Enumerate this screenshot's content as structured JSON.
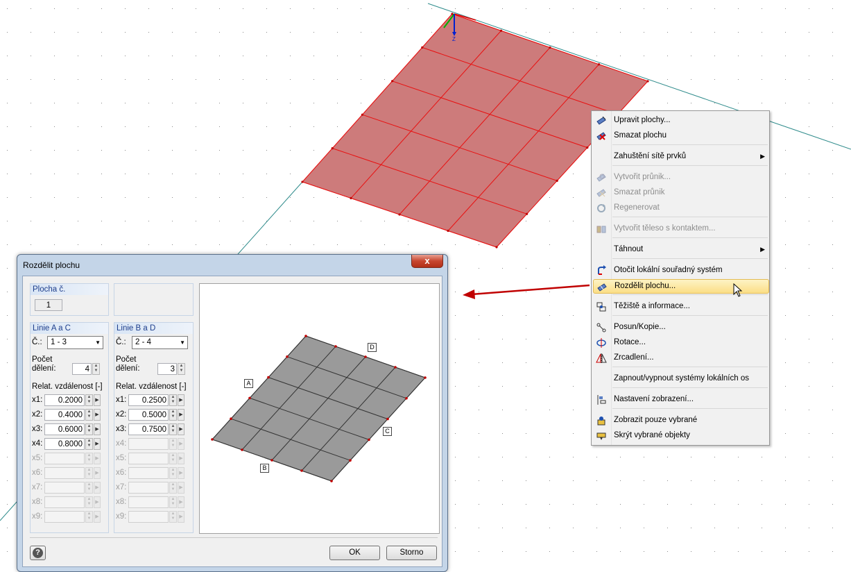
{
  "context_menu": {
    "items": [
      {
        "label": "Upravit plochy...",
        "icon": "edit-surface-icon",
        "disabled": false,
        "submenu": false
      },
      {
        "label": "Smazat plochu",
        "icon": "delete-surface-icon",
        "disabled": false,
        "submenu": false
      },
      {
        "label": "Zahuštění sítě prvků",
        "icon": "",
        "disabled": false,
        "submenu": true
      },
      {
        "label": "Vytvořit průnik...",
        "icon": "intersection-icon",
        "disabled": true,
        "submenu": false
      },
      {
        "label": "Smazat průnik",
        "icon": "delete-intersection-icon",
        "disabled": true,
        "submenu": false
      },
      {
        "label": "Regenerovat",
        "icon": "regenerate-icon",
        "disabled": true,
        "submenu": false
      },
      {
        "label": "Vytvořit těleso s kontaktem...",
        "icon": "solid-contact-icon",
        "disabled": true,
        "submenu": false
      },
      {
        "label": "Táhnout",
        "icon": "",
        "disabled": false,
        "submenu": true
      },
      {
        "label": "Otočit lokální souřadný systém",
        "icon": "rotate-axes-icon",
        "disabled": false,
        "submenu": false
      },
      {
        "label": "Rozdělit plochu...",
        "icon": "divide-surface-icon",
        "disabled": false,
        "submenu": false,
        "highlighted": true
      },
      {
        "label": "Těžiště a informace...",
        "icon": "centroid-icon",
        "disabled": false,
        "submenu": false
      },
      {
        "label": "Posun/Kopie...",
        "icon": "move-copy-icon",
        "disabled": false,
        "submenu": false
      },
      {
        "label": "Rotace...",
        "icon": "rotate-icon",
        "disabled": false,
        "submenu": false
      },
      {
        "label": "Zrcadlení...",
        "icon": "mirror-icon",
        "disabled": false,
        "submenu": false
      },
      {
        "label": "Zapnout/vypnout systémy lokálních os",
        "icon": "",
        "disabled": false,
        "submenu": false
      },
      {
        "label": "Nastavení zobrazení...",
        "icon": "display-settings-icon",
        "disabled": false,
        "submenu": false
      },
      {
        "label": "Zobrazit pouze vybrané",
        "icon": "show-selected-icon",
        "disabled": false,
        "submenu": false
      },
      {
        "label": "Skrýt vybrané objekty",
        "icon": "hide-selected-icon",
        "disabled": false,
        "submenu": false
      }
    ]
  },
  "axis": {
    "z_label": "Z"
  },
  "dialog": {
    "title": "Rozdělit plochu",
    "close_glyph": "x",
    "surface_group": {
      "header": "Plocha č.",
      "value": "1"
    },
    "group_ac": {
      "header": "Linie A a C",
      "no_label": "Č.:",
      "no_value": "1 - 3",
      "count_label_1": "Počet",
      "count_label_2": "dělení:",
      "count_value": "4",
      "rel_label": "Relat. vzdálenost [-]",
      "rows": [
        {
          "label": "x1:",
          "value": "0.2000",
          "enabled": true
        },
        {
          "label": "x2:",
          "value": "0.4000",
          "enabled": true
        },
        {
          "label": "x3:",
          "value": "0.6000",
          "enabled": true
        },
        {
          "label": "x4:",
          "value": "0.8000",
          "enabled": true
        },
        {
          "label": "x5:",
          "value": "",
          "enabled": false
        },
        {
          "label": "x6:",
          "value": "",
          "enabled": false
        },
        {
          "label": "x7:",
          "value": "",
          "enabled": false
        },
        {
          "label": "x8:",
          "value": "",
          "enabled": false
        },
        {
          "label": "x9:",
          "value": "",
          "enabled": false
        }
      ]
    },
    "group_bd": {
      "header": "Linie B a D",
      "no_label": "Č.:",
      "no_value": "2 - 4",
      "count_label_1": "Počet",
      "count_label_2": "dělení:",
      "count_value": "3",
      "rel_label": "Relat. vzdálenost [-]",
      "rows": [
        {
          "label": "x1:",
          "value": "0.2500",
          "enabled": true
        },
        {
          "label": "x2:",
          "value": "0.5000",
          "enabled": true
        },
        {
          "label": "x3:",
          "value": "0.7500",
          "enabled": true
        },
        {
          "label": "x4:",
          "value": "",
          "enabled": false
        },
        {
          "label": "x5:",
          "value": "",
          "enabled": false
        },
        {
          "label": "x6:",
          "value": "",
          "enabled": false
        },
        {
          "label": "x7:",
          "value": "",
          "enabled": false
        },
        {
          "label": "x8:",
          "value": "",
          "enabled": false
        },
        {
          "label": "x9:",
          "value": "",
          "enabled": false
        }
      ]
    },
    "preview_labels": {
      "a": "A",
      "b": "B",
      "c": "C",
      "d": "D"
    },
    "help_glyph": "?",
    "ok_label": "OK",
    "cancel_label": "Storno"
  },
  "colors": {
    "surface_fill": "#cd7b7b",
    "mesh_line": "#e81010",
    "preview_fill": "#9a9a9a",
    "arrow": "#c00000",
    "menu_highlight": "#fbde86"
  }
}
